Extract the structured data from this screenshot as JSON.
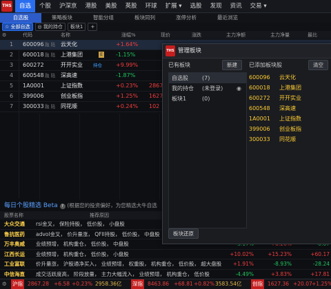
{
  "topnav": {
    "logo_text": "同花顺",
    "items": [
      "自选",
      "个股",
      "沪深京",
      "港股",
      "美股",
      "英股",
      "环球",
      "扩展 ▾",
      "选股",
      "发现",
      "资讯",
      "交易 ▾"
    ]
  },
  "subtabs": [
    "自选股",
    "策略板块",
    "智能分组",
    "板块同列",
    "涨停分析",
    "最近浏览"
  ],
  "toolbar": {
    "all_label": "全部自选",
    "hold_label": "我的持仓",
    "board_label": "板块1",
    "add_label": "+"
  },
  "table": {
    "headers": {
      "code": "代码",
      "name": "名称",
      "pct": "涨幅%",
      "price": "现价",
      "change": "涨跌",
      "flow": "主力净额",
      "amount": "主力净量",
      "rate": "最比"
    },
    "rows": [
      {
        "idx": "1",
        "code": "600096",
        "tag": "融 陆",
        "name": "云天化",
        "pct": "+1.64%",
        "dir": "up"
      },
      {
        "idx": "2",
        "code": "600018",
        "tag": "融 陆",
        "name": "上港集团",
        "pct": "-1.15%",
        "dir": "down"
      },
      {
        "idx": "3",
        "code": "600272",
        "tag": "",
        "name": "开开实业",
        "extra": "持仓",
        "pct": "+9.99%",
        "dir": "up"
      },
      {
        "idx": "4",
        "code": "600548",
        "tag": "融 陆",
        "name": "深高速",
        "pct": "-1.87%",
        "dir": "down"
      },
      {
        "idx": "5",
        "code": "1A0001",
        "tag": "",
        "name": "上证指数",
        "pct": "+0.23%",
        "extra2": "2867",
        "dir": "up"
      },
      {
        "idx": "6",
        "code": "399006",
        "tag": "",
        "name": "创业板指",
        "pct": "+1.25%",
        "extra2": "1627",
        "dir": "up"
      },
      {
        "idx": "7",
        "code": "300033",
        "tag": "融 陆",
        "name": "同花顺",
        "pct": "+0.24%",
        "extra2": "102",
        "dir": "up"
      }
    ]
  },
  "picks": {
    "title": "每日个股精选 Beta",
    "subtitle": "(根据您的投资偏好，为您精选大牛自选",
    "header_name": "股票名称",
    "header_reason": "推荐原因",
    "rows": [
      {
        "name": "大众交通",
        "reason": "rsi金叉，  保险持股，  低价股，  小盘股",
        "v1": "",
        "v2": "",
        "v3": ""
      },
      {
        "name": "鲁抗医药",
        "reason": "advol金叉，  价升量涨，  QFII持股，  低价股，  中盘股",
        "v1": "",
        "v2": "",
        "v3": ""
      },
      {
        "name": "万丰奥威",
        "reason": "业绩预增，  机构重仓，  低价股，  中盘股",
        "v1": "-3.17%",
        "v2": "+0.26%",
        "v3": "-0.07"
      },
      {
        "name": "江西长运",
        "reason": "业绩预增，  机构重仓，  低价股，  小盘股",
        "v1": "+10.02%",
        "v2": "+15.23%",
        "v3": "+60.17"
      },
      {
        "name": "工业富联",
        "reason": "价升量涨，  沪股通净买入，  业绩预增，  权重股，  机构重仓，  低价股，  超大盘股",
        "v1": "+1.91%",
        "v2": "-8.93%",
        "v3": "-28.24"
      },
      {
        "name": "中信海直",
        "reason": "成交活跃度高，  阶段放量，  主力大幅流入，  业绩预增，  机构重仓，  低价股",
        "v1": "-4.49%",
        "v2": "+3.83%",
        "v3": "+17.81"
      }
    ]
  },
  "statusbar": {
    "sh_label": "沪指",
    "sh_value": "2867.28",
    "sh_change": "+6.58",
    "sh_pct": "+0.23%",
    "sh_amount": "2958.36亿",
    "sz_label": "深指",
    "sz_value": "8463.86",
    "sz_change": "+68.81",
    "sz_pct": "+0.82%",
    "sz_amount": "3583.54亿",
    "cy_label": "创指",
    "cy_value": "1627.36",
    "cy_change": "+20.07",
    "cy_pct": "+1.25%"
  },
  "modal": {
    "title": "管理板块",
    "left_label": "已有板块",
    "new_button": "新建",
    "right_label": "已添加板块股",
    "clear_button": "清空",
    "restore_button": "板块还原",
    "boards": [
      {
        "name": "自选股",
        "count": "(7)"
      },
      {
        "name": "我的持仓",
        "count": "(未登录)"
      },
      {
        "name": "板块1",
        "count": "(0)"
      }
    ],
    "stocks": [
      {
        "code": "600096",
        "name": "云天化"
      },
      {
        "code": "600018",
        "name": "上港集团"
      },
      {
        "code": "600272",
        "name": "开开实业"
      },
      {
        "code": "600548",
        "name": "深高速"
      },
      {
        "code": "1A0001",
        "name": "上证指数"
      },
      {
        "code": "399006",
        "name": "创业板指"
      },
      {
        "code": "300033",
        "name": "同花顺"
      }
    ]
  },
  "colors": {
    "up": "#f23d3d",
    "down": "#1fc45c",
    "accent": "#2a6ef0",
    "pick_name": "#ffd24a"
  }
}
